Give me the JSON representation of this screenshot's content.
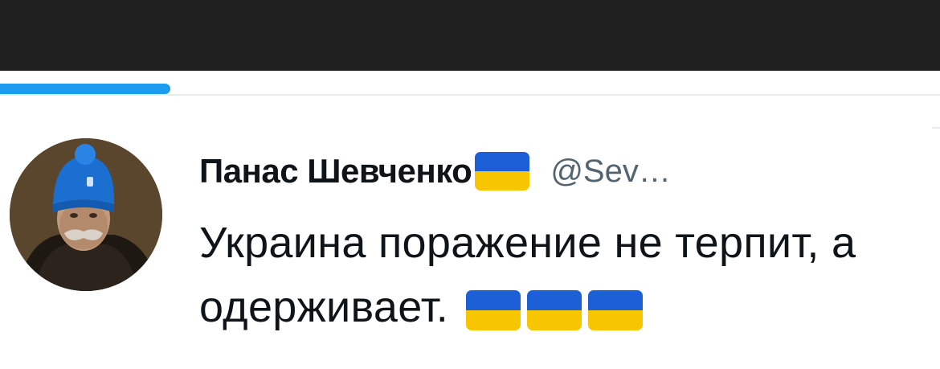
{
  "colors": {
    "flag_blue": "#1d5fd6",
    "flag_yellow": "#f7c600",
    "progress": "#1d9bf0",
    "text": "#0f1419",
    "muted": "#536471"
  },
  "tweet": {
    "display_name": "Панас Шевченко",
    "handle": "@Sev…",
    "text": "Украина поражение не терпит, а одерживает.",
    "name_badge": "ukraine-flag-icon",
    "trailing_emoji": [
      "ukraine-flag-icon",
      "ukraine-flag-icon",
      "ukraine-flag-icon"
    ]
  }
}
